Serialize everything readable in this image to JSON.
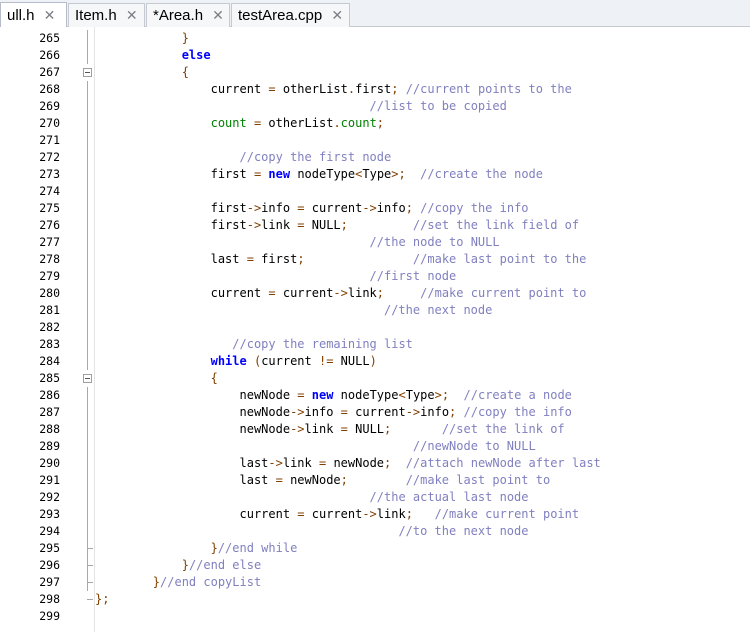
{
  "colors": {
    "keyword": "#0000ff",
    "operator": "#804000",
    "comment": "#8080c0",
    "member": "#008000",
    "tab_bar": "#eef1f5"
  },
  "tabs": [
    {
      "label": "ull.h",
      "active": true
    },
    {
      "label": "Item.h",
      "active": false
    },
    {
      "label": "*Area.h",
      "active": false
    },
    {
      "label": "testArea.cpp",
      "active": false
    }
  ],
  "tab_close_icon": "close-x-icon",
  "editor": {
    "lines": [
      {
        "n": "265",
        "segs": [
          [
            "",
            "            "
          ],
          [
            "op",
            "}"
          ]
        ]
      },
      {
        "n": "266",
        "segs": [
          [
            "",
            "            "
          ],
          [
            "kw",
            "else"
          ]
        ]
      },
      {
        "n": "267",
        "segs": [
          [
            "",
            "            "
          ],
          [
            "op",
            "{"
          ]
        ]
      },
      {
        "n": "268",
        "segs": [
          [
            "",
            "                "
          ],
          [
            "id",
            "current "
          ],
          [
            "op",
            "="
          ],
          [
            "id",
            " otherList"
          ],
          [
            "op",
            "."
          ],
          [
            "id",
            "first"
          ],
          [
            "op",
            ";"
          ],
          [
            "cm",
            " //current points to the"
          ]
        ]
      },
      {
        "n": "269",
        "segs": [
          [
            "",
            "                                      "
          ],
          [
            "cm",
            "//list to be copied"
          ]
        ]
      },
      {
        "n": "270",
        "segs": [
          [
            "",
            "                "
          ],
          [
            "gr",
            "count"
          ],
          [
            "id",
            " "
          ],
          [
            "op",
            "="
          ],
          [
            "id",
            " otherList"
          ],
          [
            "op",
            "."
          ],
          [
            "gr",
            "count"
          ],
          [
            "op",
            ";"
          ]
        ]
      },
      {
        "n": "271",
        "segs": []
      },
      {
        "n": "272",
        "segs": [
          [
            "",
            "                    "
          ],
          [
            "cm",
            "//copy the first node"
          ]
        ]
      },
      {
        "n": "273",
        "segs": [
          [
            "",
            "                "
          ],
          [
            "id",
            "first "
          ],
          [
            "op",
            "="
          ],
          [
            "id",
            " "
          ],
          [
            "kw",
            "new"
          ],
          [
            "id",
            " nodeType"
          ],
          [
            "op",
            "<"
          ],
          [
            "id",
            "Type"
          ],
          [
            "op",
            ">;"
          ],
          [
            "cm",
            "  //create the node"
          ]
        ]
      },
      {
        "n": "274",
        "segs": []
      },
      {
        "n": "275",
        "segs": [
          [
            "",
            "                "
          ],
          [
            "id",
            "first"
          ],
          [
            "op",
            "->"
          ],
          [
            "id",
            "info "
          ],
          [
            "op",
            "="
          ],
          [
            "id",
            " current"
          ],
          [
            "op",
            "->"
          ],
          [
            "id",
            "info"
          ],
          [
            "op",
            ";"
          ],
          [
            "cm",
            " //copy the info"
          ]
        ]
      },
      {
        "n": "276",
        "segs": [
          [
            "",
            "                "
          ],
          [
            "id",
            "first"
          ],
          [
            "op",
            "->"
          ],
          [
            "id",
            "link "
          ],
          [
            "op",
            "="
          ],
          [
            "id",
            " NULL"
          ],
          [
            "op",
            ";"
          ],
          [
            "id",
            "         "
          ],
          [
            "cm",
            "//set the link field of"
          ]
        ]
      },
      {
        "n": "277",
        "segs": [
          [
            "",
            "                                      "
          ],
          [
            "cm",
            "//the node to NULL"
          ]
        ]
      },
      {
        "n": "278",
        "segs": [
          [
            "",
            "                "
          ],
          [
            "id",
            "last "
          ],
          [
            "op",
            "="
          ],
          [
            "id",
            " first"
          ],
          [
            "op",
            ";"
          ],
          [
            "id",
            "               "
          ],
          [
            "cm",
            "//make last point to the"
          ]
        ]
      },
      {
        "n": "279",
        "segs": [
          [
            "",
            "                                      "
          ],
          [
            "cm",
            "//first node"
          ]
        ]
      },
      {
        "n": "280",
        "segs": [
          [
            "",
            "                "
          ],
          [
            "id",
            "current "
          ],
          [
            "op",
            "="
          ],
          [
            "id",
            " current"
          ],
          [
            "op",
            "->"
          ],
          [
            "id",
            "link"
          ],
          [
            "op",
            ";"
          ],
          [
            "id",
            "     "
          ],
          [
            "cm",
            "//make current point to"
          ]
        ]
      },
      {
        "n": "281",
        "segs": [
          [
            "",
            "                                        "
          ],
          [
            "cm",
            "//the next node"
          ]
        ]
      },
      {
        "n": "282",
        "segs": []
      },
      {
        "n": "283",
        "segs": [
          [
            "",
            "                   "
          ],
          [
            "cm",
            "//copy the remaining list"
          ]
        ]
      },
      {
        "n": "284",
        "segs": [
          [
            "",
            "                "
          ],
          [
            "kw",
            "while"
          ],
          [
            "id",
            " "
          ],
          [
            "op",
            "("
          ],
          [
            "id",
            "current "
          ],
          [
            "op",
            "!="
          ],
          [
            "id",
            " NULL"
          ],
          [
            "op",
            ")"
          ]
        ]
      },
      {
        "n": "285",
        "segs": [
          [
            "",
            "                "
          ],
          [
            "op",
            "{"
          ]
        ]
      },
      {
        "n": "286",
        "segs": [
          [
            "",
            "                    "
          ],
          [
            "id",
            "newNode "
          ],
          [
            "op",
            "="
          ],
          [
            "id",
            " "
          ],
          [
            "kw",
            "new"
          ],
          [
            "id",
            " nodeType"
          ],
          [
            "op",
            "<"
          ],
          [
            "id",
            "Type"
          ],
          [
            "op",
            ">;"
          ],
          [
            "cm",
            "  //create a node"
          ]
        ]
      },
      {
        "n": "287",
        "segs": [
          [
            "",
            "                    "
          ],
          [
            "id",
            "newNode"
          ],
          [
            "op",
            "->"
          ],
          [
            "id",
            "info "
          ],
          [
            "op",
            "="
          ],
          [
            "id",
            " current"
          ],
          [
            "op",
            "->"
          ],
          [
            "id",
            "info"
          ],
          [
            "op",
            ";"
          ],
          [
            "cm",
            " //copy the info"
          ]
        ]
      },
      {
        "n": "288",
        "segs": [
          [
            "",
            "                    "
          ],
          [
            "id",
            "newNode"
          ],
          [
            "op",
            "->"
          ],
          [
            "id",
            "link "
          ],
          [
            "op",
            "="
          ],
          [
            "id",
            " NULL"
          ],
          [
            "op",
            ";"
          ],
          [
            "id",
            "       "
          ],
          [
            "cm",
            "//set the link of"
          ]
        ]
      },
      {
        "n": "289",
        "segs": [
          [
            "",
            "                                            "
          ],
          [
            "cm",
            "//newNode to NULL"
          ]
        ]
      },
      {
        "n": "290",
        "segs": [
          [
            "",
            "                    "
          ],
          [
            "id",
            "last"
          ],
          [
            "op",
            "->"
          ],
          [
            "id",
            "link "
          ],
          [
            "op",
            "="
          ],
          [
            "id",
            " newNode"
          ],
          [
            "op",
            ";"
          ],
          [
            "cm",
            "  //attach newNode after last"
          ]
        ]
      },
      {
        "n": "291",
        "segs": [
          [
            "",
            "                    "
          ],
          [
            "id",
            "last "
          ],
          [
            "op",
            "="
          ],
          [
            "id",
            " newNode"
          ],
          [
            "op",
            ";"
          ],
          [
            "id",
            "        "
          ],
          [
            "cm",
            "//make last point to"
          ]
        ]
      },
      {
        "n": "292",
        "segs": [
          [
            "",
            "                                      "
          ],
          [
            "cm",
            "//the actual last node"
          ]
        ]
      },
      {
        "n": "293",
        "segs": [
          [
            "",
            "                    "
          ],
          [
            "id",
            "current "
          ],
          [
            "op",
            "="
          ],
          [
            "id",
            " current"
          ],
          [
            "op",
            "->"
          ],
          [
            "id",
            "link"
          ],
          [
            "op",
            ";"
          ],
          [
            "id",
            "   "
          ],
          [
            "cm",
            "//make current point"
          ]
        ]
      },
      {
        "n": "294",
        "segs": [
          [
            "",
            "                                          "
          ],
          [
            "cm",
            "//to the next node"
          ]
        ]
      },
      {
        "n": "295",
        "segs": [
          [
            "",
            "                "
          ],
          [
            "op",
            "}"
          ],
          [
            "cm",
            "//end while"
          ]
        ]
      },
      {
        "n": "296",
        "segs": [
          [
            "",
            "            "
          ],
          [
            "op",
            "}"
          ],
          [
            "cm",
            "//end else"
          ]
        ]
      },
      {
        "n": "297",
        "segs": [
          [
            "",
            "        "
          ],
          [
            "op",
            "}"
          ],
          [
            "cm",
            "//end copyList"
          ]
        ]
      },
      {
        "n": "298",
        "segs": [
          [
            "op",
            "};"
          ]
        ]
      },
      {
        "n": "299",
        "segs": []
      }
    ]
  }
}
